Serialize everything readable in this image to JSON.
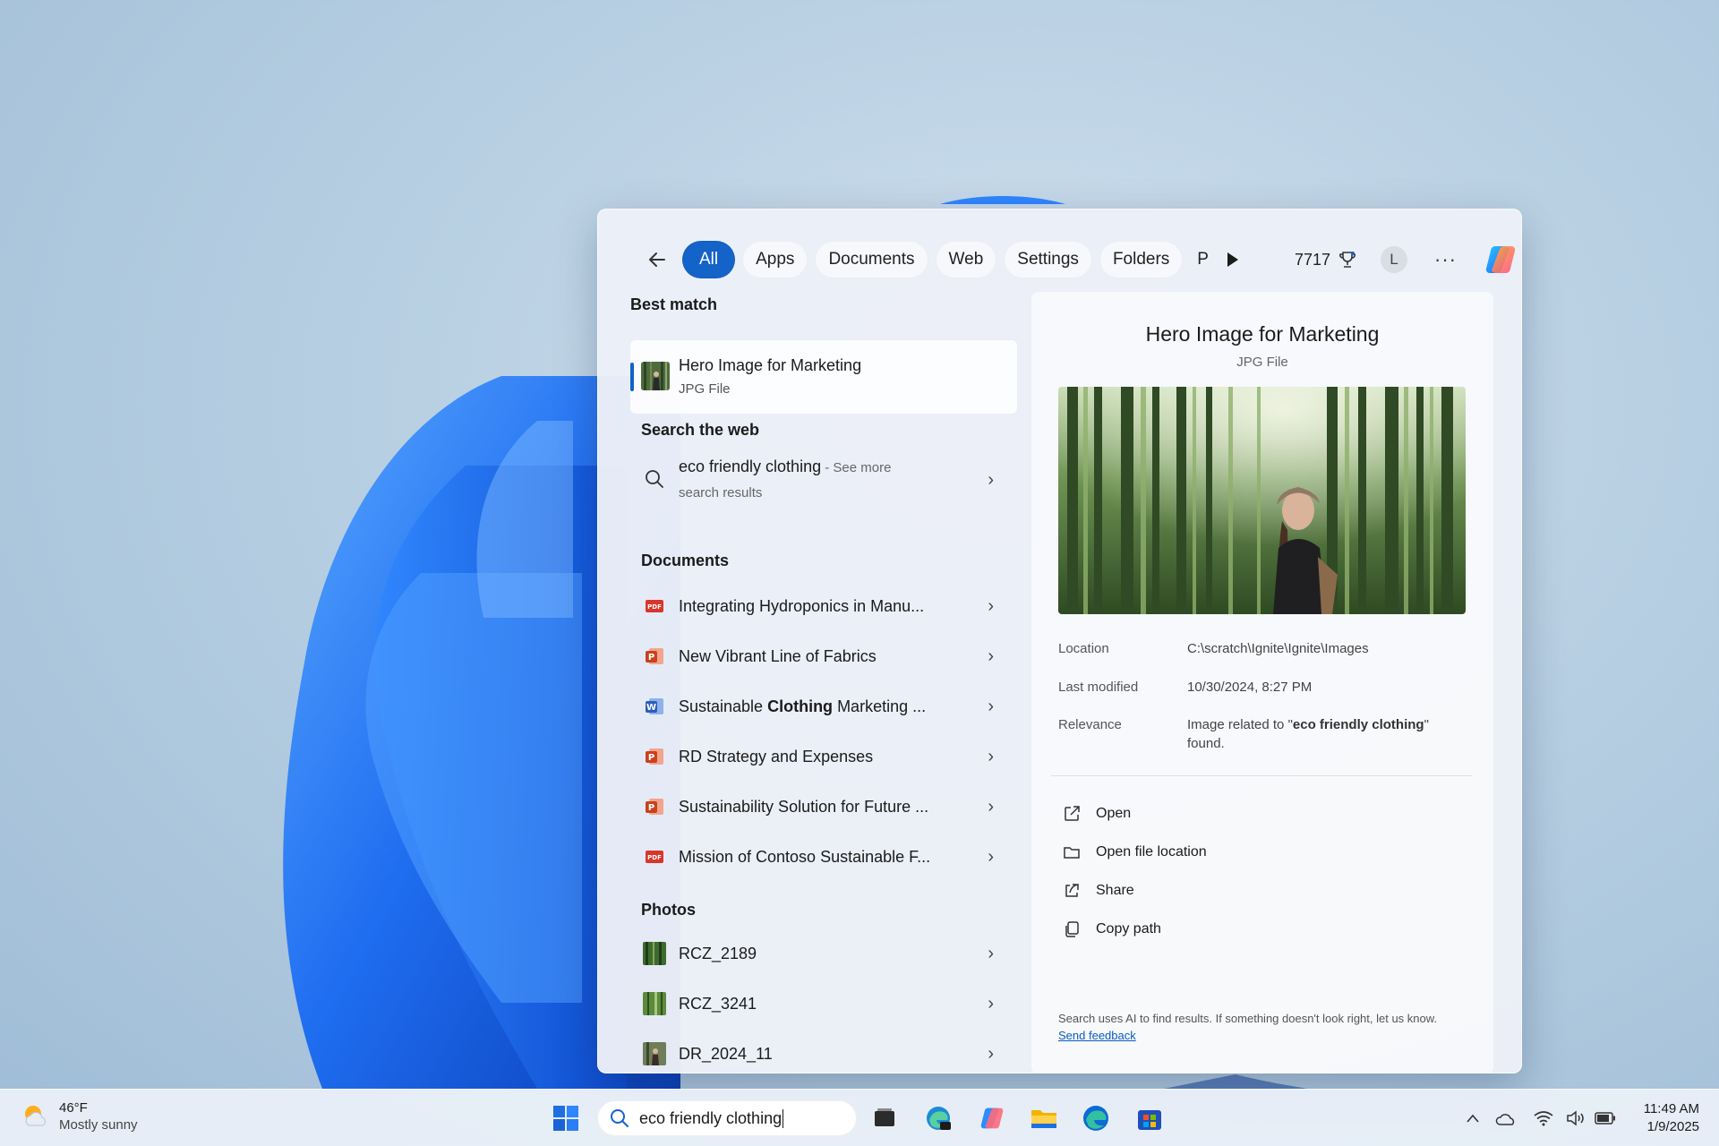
{
  "search": {
    "tabs": [
      {
        "label": "All",
        "active": true
      },
      {
        "label": "Apps"
      },
      {
        "label": "Documents"
      },
      {
        "label": "Web"
      },
      {
        "label": "Settings"
      },
      {
        "label": "Folders"
      },
      {
        "label": "P"
      }
    ],
    "points": "7717",
    "avatar_initial": "L",
    "more_label": "···"
  },
  "results": {
    "best_match_title": "Best match",
    "best_match": {
      "title": "Hero Image for Marketing",
      "subtitle": "JPG File"
    },
    "web_title": "Search the web",
    "web": {
      "query": "eco friendly clothing",
      "suffix": " - See more",
      "suffix2": "search results"
    },
    "documents_title": "Documents",
    "documents": [
      {
        "label": "Integrating Hydroponics in Manu...",
        "icon": "pdf-icon"
      },
      {
        "label": "New Vibrant Line of Fabrics",
        "icon": "powerpoint-icon"
      },
      {
        "label_pre": "Sustainable ",
        "label_bold": "Clothing",
        "label_post": " Marketing ...",
        "icon": "word-icon"
      },
      {
        "label": "RD Strategy and Expenses",
        "icon": "powerpoint-icon"
      },
      {
        "label": "Sustainability Solution for Future ...",
        "icon": "powerpoint-icon"
      },
      {
        "label": "Mission of Contoso Sustainable F...",
        "icon": "pdf-icon"
      }
    ],
    "photos_title": "Photos",
    "photos": [
      {
        "label": "RCZ_2189"
      },
      {
        "label": "RCZ_3241"
      },
      {
        "label": "DR_2024_11"
      }
    ]
  },
  "preview": {
    "title": "Hero Image for Marketing",
    "subtitle": "JPG File",
    "location_label": "Location",
    "location_value": "C:\\scratch\\Ignite\\Ignite\\Images",
    "modified_label": "Last modified",
    "modified_value": "10/30/2024, 8:27 PM",
    "relevance_label": "Relevance",
    "relevance_value_pre": "Image related to \"",
    "relevance_value_bold": "eco friendly clothing",
    "relevance_value_post": "\" found.",
    "actions": [
      "Open",
      "Open file location",
      "Share",
      "Copy path"
    ],
    "disclaimer": "Search uses AI to find results. If something doesn't look right, let us know.",
    "feedback_link": "Send feedback"
  },
  "taskbar": {
    "temperature": "46°F",
    "condition": "Mostly sunny",
    "search_text": "eco friendly clothing",
    "time": "11:49 AM",
    "date": "1/9/2025"
  },
  "colors": {
    "accent": "#1463c9",
    "pdf": "#d9362b",
    "powerpoint": "#c8421e",
    "word": "#2b5fb8"
  }
}
